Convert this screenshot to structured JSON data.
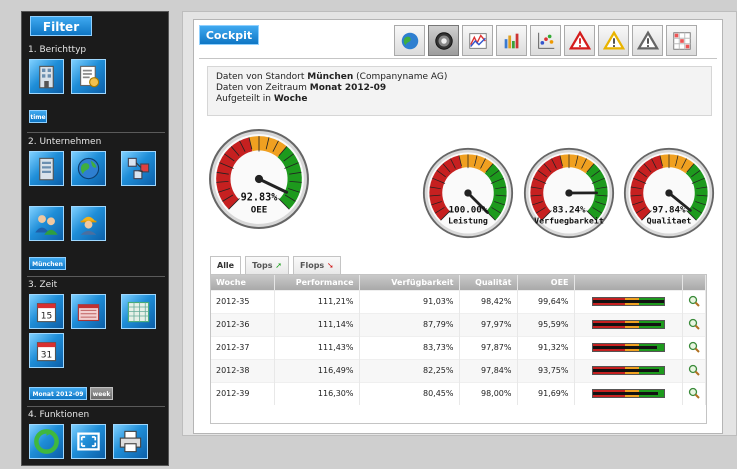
{
  "sidebar": {
    "title": "Filter",
    "sections": {
      "berichtstyp": "1. Berichttyp",
      "unternehmen": "2. Unternehmen",
      "zeit": "3. Zeit",
      "funktionen": "4. Funktionen"
    },
    "tags": {
      "time": "time",
      "muenchen": "München",
      "monat": "Monat 2012-09",
      "week": "week"
    },
    "icons": [
      "building-icon",
      "report-icon",
      "factory-icon",
      "globe-icon",
      "network-icon",
      "users-icon",
      "worker-icon",
      "calendar-15-icon",
      "calendar-month-icon",
      "calendar-year-icon",
      "calendar-31-icon",
      "refresh-icon",
      "fullscreen-icon",
      "printer-icon"
    ]
  },
  "main": {
    "title": "Cockpit",
    "toolbar": [
      "globe-icon",
      "gauge-icon",
      "line-chart-icon",
      "bar-chart-icon",
      "scatter-chart-icon",
      "warning-red-icon",
      "warning-yellow-icon",
      "warning-grey-icon",
      "grid-chart-icon"
    ],
    "info": {
      "line1_prefix": "Daten von Standort ",
      "line1_bold": "München",
      "line1_suffix": " (Companyname AG)",
      "line2_prefix": "Daten von Zeitraum ",
      "line2_bold": "Monat 2012-09",
      "line3_prefix": "Aufgeteilt in ",
      "line3_bold": "Woche"
    },
    "gauges": [
      {
        "value": "92.83%",
        "label": "OEE",
        "fraction": 0.9283
      },
      {
        "value": "100.00%",
        "label": "Leistung",
        "fraction": 1.0
      },
      {
        "value": "83.24%",
        "label": "Verfuegbarkeit",
        "fraction": 0.8324
      },
      {
        "value": "97.84%",
        "label": "Qualitaet",
        "fraction": 0.9784
      }
    ],
    "tabs": {
      "alle": "Alle",
      "tops": "Tops",
      "flops": "Flops"
    },
    "table": {
      "headers": [
        "Woche",
        "Performance",
        "Verfügbarkeit",
        "Qualität",
        "OEE",
        "",
        ""
      ],
      "rows": [
        {
          "woche": "2012-35",
          "performance": "111,21%",
          "verfuegbarkeit": "91,03%",
          "qualitaet": "98,42%",
          "oee": "99,64%",
          "level": 0.9964
        },
        {
          "woche": "2012-36",
          "performance": "111,14%",
          "verfuegbarkeit": "87,79%",
          "qualitaet": "97,97%",
          "oee": "95,59%",
          "level": 0.9559
        },
        {
          "woche": "2012-37",
          "performance": "111,43%",
          "verfuegbarkeit": "83,73%",
          "qualitaet": "97,87%",
          "oee": "91,32%",
          "level": 0.9132
        },
        {
          "woche": "2012-38",
          "performance": "116,49%",
          "verfuegbarkeit": "82,25%",
          "qualitaet": "97,84%",
          "oee": "93,75%",
          "level": 0.9375
        },
        {
          "woche": "2012-39",
          "performance": "116,30%",
          "verfuegbarkeit": "80,45%",
          "qualitaet": "98,00%",
          "oee": "91,69%",
          "level": 0.9169
        }
      ]
    }
  },
  "colors": {
    "accent": "#1a86d6",
    "red": "#c62020",
    "orange": "#f0a020",
    "green": "#1d9a1d"
  }
}
